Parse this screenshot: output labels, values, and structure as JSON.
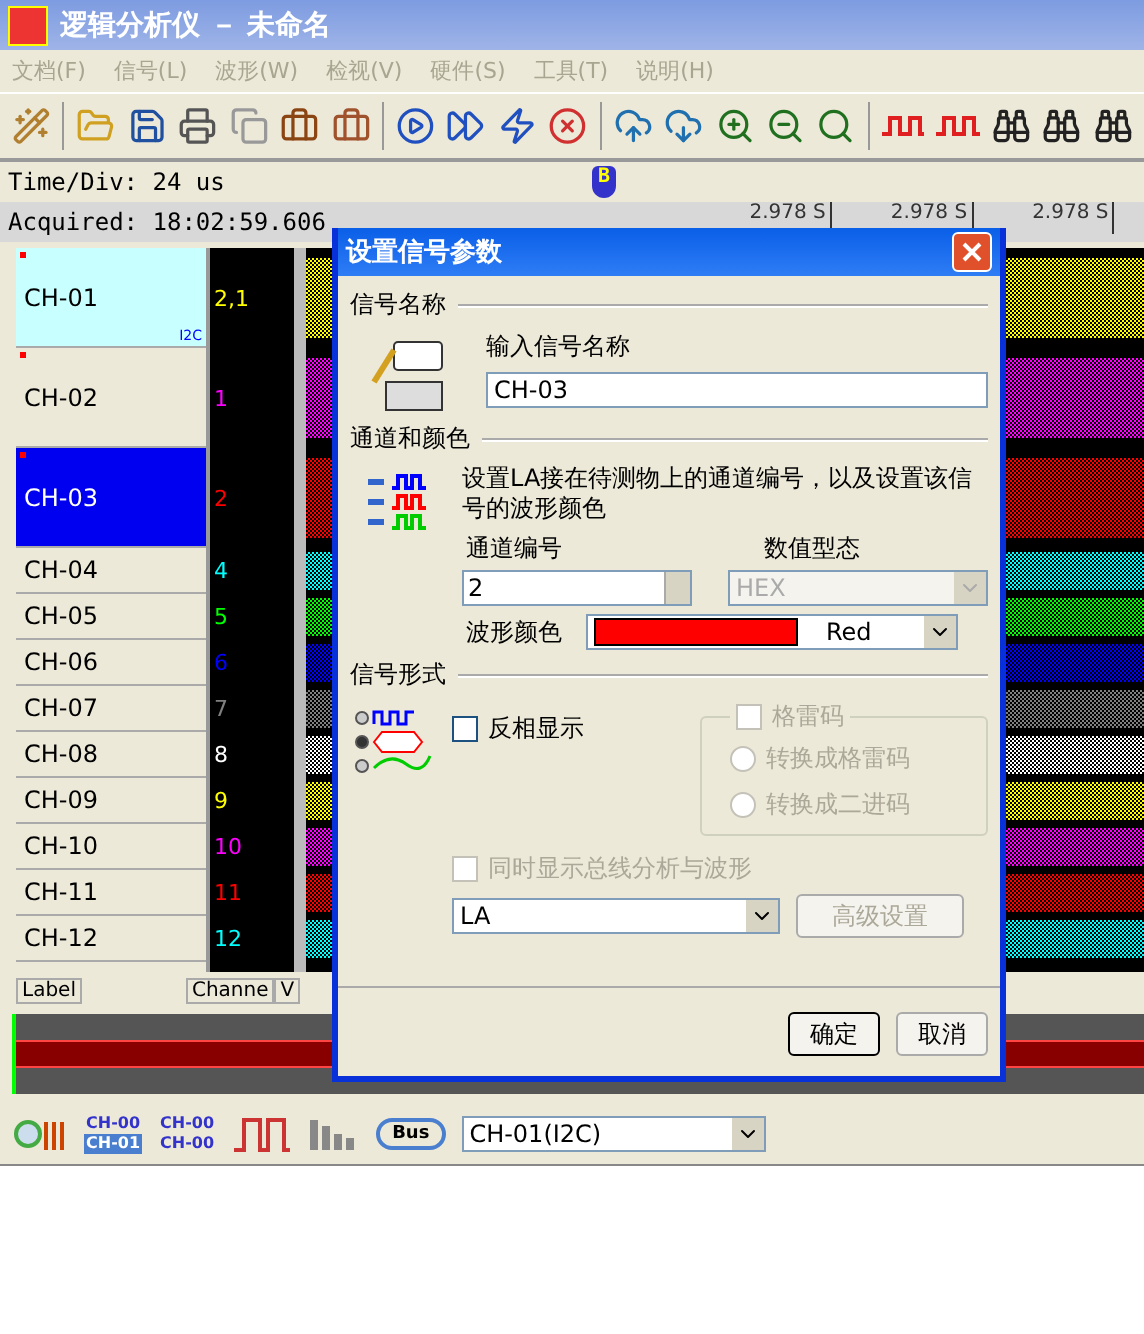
{
  "window": {
    "title": "逻辑分析仪 － 未命名"
  },
  "menu": [
    {
      "label": "文档(F)",
      "disabled": true
    },
    {
      "label": "信号(L)",
      "disabled": true
    },
    {
      "label": "波形(W)",
      "disabled": true
    },
    {
      "label": "检视(V)",
      "disabled": true
    },
    {
      "label": "硬件(S)",
      "disabled": true
    },
    {
      "label": "工具(T)",
      "disabled": true
    },
    {
      "label": "说明(H)",
      "disabled": true
    }
  ],
  "time_div": "Time/Div: 24 us",
  "marker": "B",
  "acquired": "Acquired: 18:02:59.606",
  "ruler_ticks": [
    "2.978 S",
    "2.978 S",
    "2.978 S"
  ],
  "channels": [
    {
      "name": "CH-01",
      "number": "2,1",
      "color": "#ffff00",
      "selected": false,
      "marked": true,
      "badge": "I2C"
    },
    {
      "name": "CH-02",
      "number": "1",
      "color": "#ff00ff",
      "selected": false,
      "marked": true
    },
    {
      "name": "CH-03",
      "number": "2",
      "color": "#ff0000",
      "selected": true,
      "marked": true
    },
    {
      "name": "CH-04",
      "number": "4",
      "color": "#00ffff",
      "selected": false,
      "marked": false
    },
    {
      "name": "CH-05",
      "number": "5",
      "color": "#00ff00",
      "selected": false,
      "marked": false
    },
    {
      "name": "CH-06",
      "number": "6",
      "color": "#0000ff",
      "selected": false,
      "marked": false
    },
    {
      "name": "CH-07",
      "number": "7",
      "color": "#808080",
      "selected": false,
      "marked": false
    },
    {
      "name": "CH-08",
      "number": "8",
      "color": "#ffffff",
      "selected": false,
      "marked": false
    },
    {
      "name": "CH-09",
      "number": "9",
      "color": "#ffff00",
      "selected": false,
      "marked": false
    },
    {
      "name": "CH-10",
      "number": "10",
      "color": "#ff00ff",
      "selected": false,
      "marked": false
    },
    {
      "name": "CH-11",
      "number": "11",
      "color": "#ff0000",
      "selected": false,
      "marked": false
    },
    {
      "name": "CH-12",
      "number": "12",
      "color": "#00ffff",
      "selected": false,
      "marked": false
    }
  ],
  "column_headers": [
    "Label",
    "Channe",
    "V"
  ],
  "bottom_toolbar": {
    "channel_icon_a": [
      "CH-00",
      "CH-01"
    ],
    "channel_icon_b": [
      "CH-00",
      "CH-00"
    ],
    "bus_icon": "Bus",
    "select": "CH-01(I2C)"
  },
  "dialog": {
    "title": "设置信号参数",
    "name_section": {
      "heading": "信号名称",
      "prompt": "输入信号名称",
      "value": "CH-03"
    },
    "channel_section": {
      "heading": "通道和颜色",
      "description": "设置LA接在待测物上的通道编号，以及设置该信号的波形颜色",
      "channel_label": "通道编号",
      "channel_value": "2",
      "value_type_label": "数值型态",
      "value_type": {
        "value": "HEX",
        "disabled": true
      },
      "color_label": "波形颜色",
      "color": {
        "name": "Red",
        "color": "#ff0000"
      }
    },
    "format_section": {
      "heading": "信号形式",
      "invert": {
        "label": "反相显示",
        "checked": false,
        "disabled": false
      },
      "gray_code": {
        "label": "格雷码",
        "checked": false,
        "disabled": true,
        "options": [
          {
            "label": "转换成格雷码",
            "selected": false,
            "disabled": true
          },
          {
            "label": "转换成二进码",
            "selected": false,
            "disabled": true
          }
        ]
      },
      "show_both": {
        "label": "同时显示总线分析与波形",
        "checked": false,
        "disabled": true
      },
      "mode": "LA",
      "advanced": {
        "label": "高级设置",
        "disabled": true
      }
    },
    "buttons": [
      "确定",
      "取消"
    ]
  }
}
